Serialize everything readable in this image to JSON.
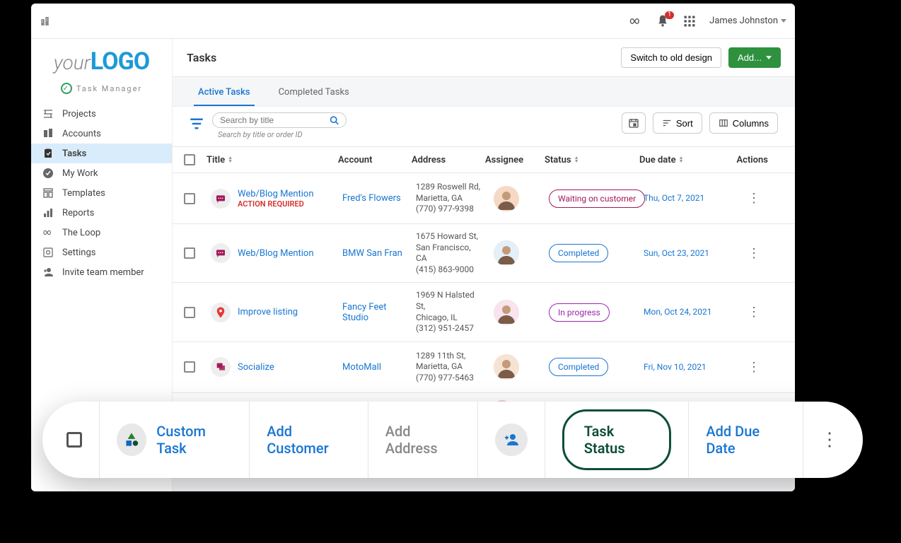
{
  "topbar": {
    "notif_count": "1",
    "user_name": "James Johnston"
  },
  "logo": {
    "part1": "your",
    "part2": "LOGO",
    "subtitle": "Task Manager"
  },
  "nav": [
    {
      "label": "Projects"
    },
    {
      "label": "Accounts"
    },
    {
      "label": "Tasks"
    },
    {
      "label": "My Work"
    },
    {
      "label": "Templates"
    },
    {
      "label": "Reports"
    },
    {
      "label": "The Loop"
    },
    {
      "label": "Settings"
    },
    {
      "label": "Invite team member"
    }
  ],
  "header": {
    "title": "Tasks",
    "switch_btn": "Switch to old design",
    "add_btn": "Add..."
  },
  "tabs": {
    "active": "Active Tasks",
    "completed": "Completed Tasks"
  },
  "toolbar": {
    "search_placeholder": "Search by title",
    "search_hint": "Search by title or order ID",
    "sort_label": "Sort",
    "columns_label": "Columns"
  },
  "columns": {
    "title": "Title",
    "account": "Account",
    "address": "Address",
    "assignee": "Assignee",
    "status": "Status",
    "due_date": "Due date",
    "actions": "Actions"
  },
  "rows": [
    {
      "title": "Web/Blog Mention",
      "flag": "ACTION REQUIRED",
      "account": "Fred's Flowers",
      "addr1": "1289 Roswell Rd,",
      "addr2": "Marietta, GA",
      "addr3": "(770) 977-9398",
      "status": "Waiting on customer",
      "status_class": "status-waiting",
      "due": "Thu, Oct 7, 2021",
      "icon": "chat"
    },
    {
      "title": "Web/Blog Mention",
      "flag": "",
      "account": "BMW San Fran",
      "addr1": "1675 Howard St,",
      "addr2": "San Francisco, CA",
      "addr3": "(415) 863-9000",
      "status": "Completed",
      "status_class": "status-completed",
      "due": "Sun, Oct 23, 2021",
      "icon": "chat"
    },
    {
      "title": "Improve listing",
      "flag": "",
      "account": "Fancy Feet Studio",
      "addr1": "1969 N Halsted St,",
      "addr2": "Chicago, IL",
      "addr3": "(312) 951-2457",
      "status": "In progress",
      "status_class": "status-progress",
      "due": "Mon, Oct 24, 2021",
      "icon": "map"
    },
    {
      "title": "Socialize",
      "flag": "",
      "account": "MotoMall",
      "addr1": "1289 11th St,",
      "addr2": "Marietta, GA",
      "addr3": "(770) 977-5463",
      "status": "Completed",
      "status_class": "status-completed",
      "due": "Fri, Nov 10, 2021",
      "icon": "social"
    }
  ],
  "floating": {
    "custom_task": "Custom Task",
    "add_customer": "Add Customer",
    "add_address": "Add Address",
    "task_status": "Task Status",
    "add_due_date": "Add Due Date"
  }
}
